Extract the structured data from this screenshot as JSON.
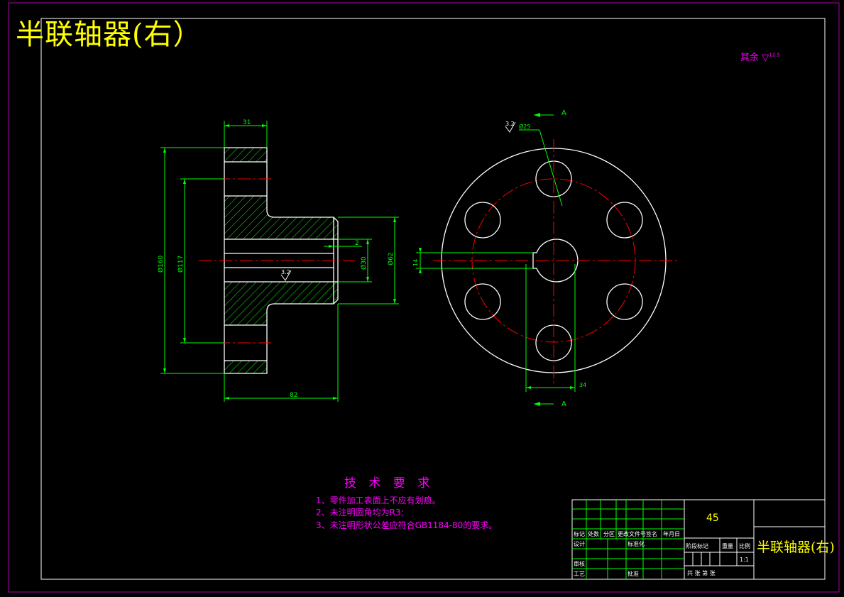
{
  "title": "半联轴器(右）",
  "roughness_note": {
    "prefix": "其余",
    "symbol": "▽",
    "value": "12.5"
  },
  "tech_requirements": {
    "heading": "技 术 要 求",
    "items": [
      "1、零件加工表面上不应有划痕。",
      "2、未注明圆角均为R3;",
      "3、未注明形状公差应符合GB1184-80的要求。"
    ]
  },
  "dimensions": {
    "width_31": "31",
    "length_82": "82",
    "dia_160": "Ø160",
    "dia_117": "Ø117",
    "dia_30": "Ø30",
    "dia_62": "Ø62",
    "chamfer_2": "2",
    "hole_25": "Ø25",
    "keyway_34": "34",
    "keyway_14": "14",
    "roughness_32": "3.2",
    "section_label": "A"
  },
  "title_block": {
    "material": "45",
    "part_name": "半联轴器(右)",
    "header_labels": [
      "标记",
      "处数",
      "分区",
      "更改文件号",
      "签名",
      "年月日"
    ],
    "left_labels": [
      "设计",
      "标准化",
      "审核",
      "工艺",
      "批准"
    ],
    "mid_labels": [
      "阶段标记",
      "重量",
      "比例"
    ],
    "scale": "1:1",
    "sheet_text": "共 张 第 张"
  },
  "colors": {
    "background": "#000000",
    "outline": "#ffffff",
    "dimension": "#00ff00",
    "centerline": "#ff0000",
    "text_magenta": "#ff00ff",
    "title_yellow": "#ffff00",
    "frame": "#aa00aa"
  }
}
